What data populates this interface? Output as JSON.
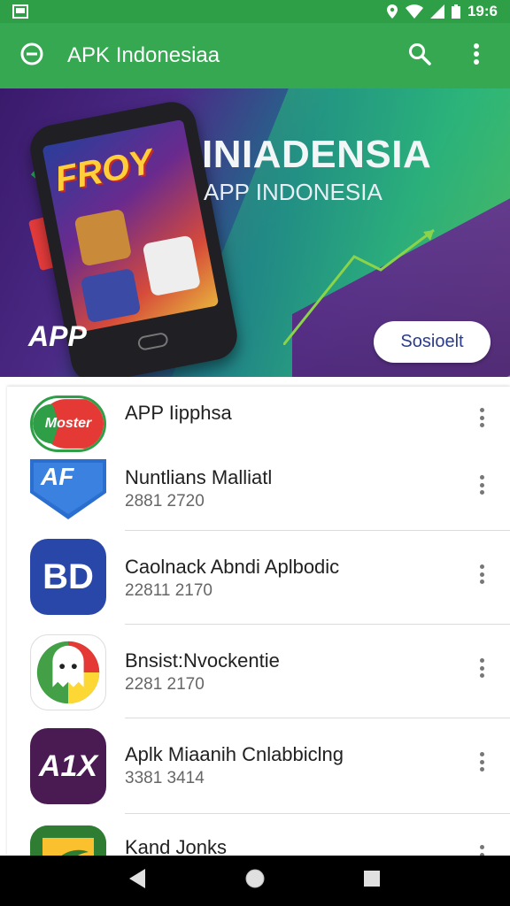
{
  "status_bar": {
    "time": "19:6"
  },
  "app_bar": {
    "title": "APK Indonesiaa"
  },
  "banner": {
    "heading": "INIADENSIA",
    "subheading": "APP INDONESIA",
    "phone_text": "FROY",
    "logo_text": "APP",
    "button_label": "Sosioelt"
  },
  "apps": [
    {
      "name": "APP Iipphsa",
      "meta": "",
      "icon_text": "Moster",
      "icon_name": "moster-app-icon",
      "colors": [
        "#e53935",
        "#2e9e47"
      ]
    },
    {
      "name": "Nuntlians Malliatl",
      "meta": "2881 2720",
      "icon_text": "AF",
      "icon_name": "af-shield-app-icon",
      "colors": [
        "#2a6fcf"
      ]
    },
    {
      "name": "Caolnack Abndi Aplbodic",
      "meta": "22811 2170",
      "icon_text": "BD",
      "icon_name": "bd-app-icon",
      "colors": [
        "#2847a8"
      ]
    },
    {
      "name": "Bnsist:Nvockentie",
      "meta": "2281 2170",
      "icon_text": "",
      "icon_name": "ghost-app-icon",
      "colors": [
        "#e53935",
        "#43a047",
        "#fdd835"
      ]
    },
    {
      "name": "Aplk Miaanih Cnlabbiclng",
      "meta": "3381 3414",
      "icon_text": "A1X",
      "icon_name": "a1x-app-icon",
      "colors": [
        "#4a1a52"
      ]
    },
    {
      "name": "Kand Jonks",
      "meta": "",
      "icon_text": "",
      "icon_name": "bird-app-icon",
      "colors": [
        "#2e7d32",
        "#fbc02d"
      ]
    }
  ]
}
